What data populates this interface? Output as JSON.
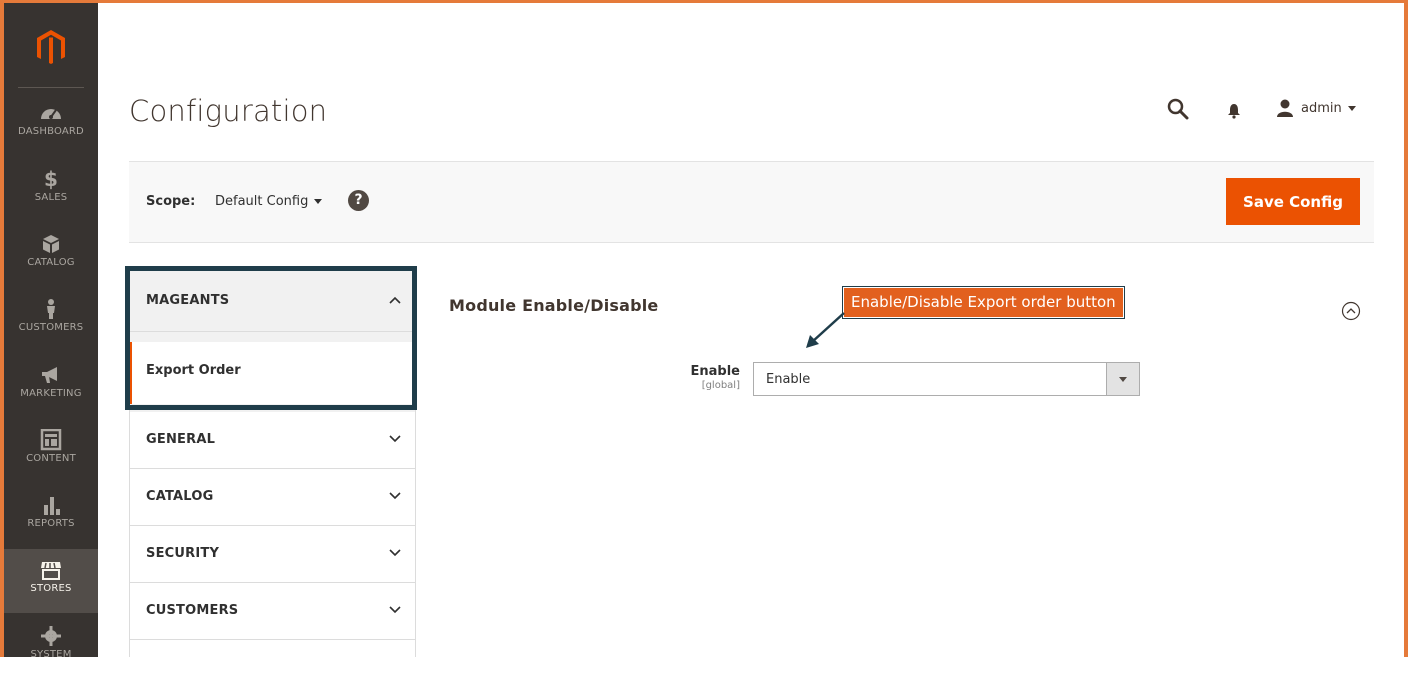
{
  "nav": {
    "items": [
      {
        "label": "DASHBOARD",
        "icon": "dashboard-icon"
      },
      {
        "label": "SALES",
        "icon": "dollar-icon"
      },
      {
        "label": "CATALOG",
        "icon": "cube-icon"
      },
      {
        "label": "CUSTOMERS",
        "icon": "person-icon"
      },
      {
        "label": "MARKETING",
        "icon": "megaphone-icon"
      },
      {
        "label": "CONTENT",
        "icon": "layout-icon"
      },
      {
        "label": "REPORTS",
        "icon": "bar-chart-icon"
      },
      {
        "label": "STORES",
        "icon": "storefront-icon"
      },
      {
        "label": "SYSTEM",
        "icon": "gear-icon"
      }
    ]
  },
  "header": {
    "title": "Configuration",
    "user": "admin"
  },
  "scope": {
    "label": "Scope:",
    "value": "Default Config",
    "help": "?",
    "save_label": "Save Config"
  },
  "tabs": {
    "mageants": {
      "label": "MAGEANTS",
      "sub": "Export Order"
    },
    "general": "GENERAL",
    "catalog": "CATALOG",
    "security": "SECURITY",
    "customers": "CUSTOMERS"
  },
  "section": {
    "title": "Module Enable/Disable",
    "field_label": "Enable",
    "field_scope": "[global]",
    "field_value": "Enable"
  },
  "annotation": {
    "text": "Enable/Disable Export order button"
  },
  "colors": {
    "accent": "#eb5202",
    "nav_bg": "#373330",
    "highlight": "#1f3d4a",
    "frame": "#e57a3a"
  }
}
